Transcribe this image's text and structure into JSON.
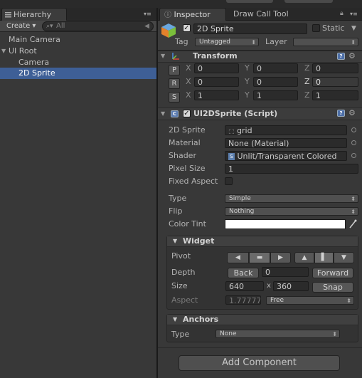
{
  "hierarchy": {
    "tab_label": "Hierarchy",
    "create_label": "Create ▾",
    "search_placeholder": "All",
    "items": [
      {
        "label": "Main Camera"
      },
      {
        "label": "UI Root",
        "expanded": true
      },
      {
        "label": "Camera"
      },
      {
        "label": "2D Sprite",
        "selected": true
      }
    ]
  },
  "inspector": {
    "tabs": [
      {
        "label": "Inspector",
        "active": true
      },
      {
        "label": "Draw Call Tool",
        "active": false
      }
    ],
    "object": {
      "name": "2D Sprite",
      "active": true,
      "static_label": "Static",
      "tag_label": "Tag",
      "tag_value": "Untagged",
      "layer_label": "Layer",
      "layer_value": ""
    },
    "transform": {
      "title": "Transform",
      "rows": [
        {
          "button": "P",
          "x": "0",
          "y": "0",
          "z": "0"
        },
        {
          "button": "R",
          "x": "0",
          "y": "0",
          "z": "0"
        },
        {
          "button": "S",
          "x": "1",
          "y": "1",
          "z": "1"
        }
      ],
      "axis_labels": [
        "X",
        "Y",
        "Z"
      ]
    },
    "script": {
      "title": "UI2DSprite (Script)",
      "enabled": true,
      "props": {
        "sprite_label": "2D Sprite",
        "sprite_value": "grid",
        "material_label": "Material",
        "material_value": "None (Material)",
        "shader_label": "Shader",
        "shader_value": "Unlit/Transparent Colored",
        "pixel_size_label": "Pixel Size",
        "pixel_size_value": "1",
        "fixed_aspect_label": "Fixed Aspect",
        "type_label": "Type",
        "type_value": "Simple",
        "flip_label": "Flip",
        "flip_value": "Nothing",
        "tint_label": "Color Tint",
        "tint_color": "#ffffff"
      }
    },
    "widget": {
      "title": "Widget",
      "pivot_label": "Pivot",
      "depth_label": "Depth",
      "back_label": "Back",
      "depth_value": "0",
      "forward_label": "Forward",
      "size_label": "Size",
      "width": "640",
      "x_sep": "x",
      "height": "360",
      "snap_label": "Snap",
      "aspect_label": "Aspect",
      "aspect_value": "1.77777",
      "aspect_mode": "Free"
    },
    "anchors": {
      "title": "Anchors",
      "type_label": "Type",
      "type_value": "None"
    },
    "add_component_label": "Add Component"
  },
  "colors": {
    "selection": "#3e5f96",
    "panel_bg": "#383838",
    "field_bg": "#2b2b2b"
  }
}
